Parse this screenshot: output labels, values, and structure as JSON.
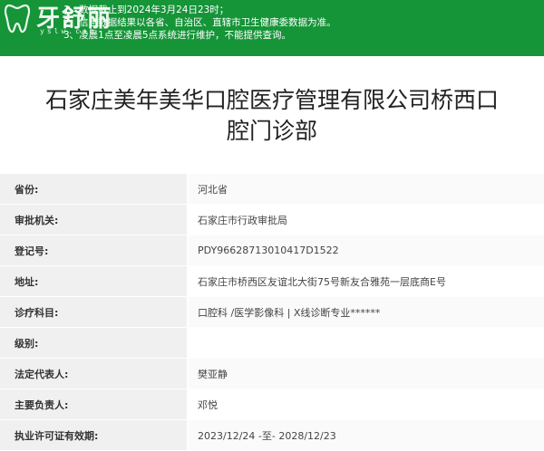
{
  "brand": {
    "logo_text": "牙舒丽",
    "logo_url": "yslw.com"
  },
  "notice": {
    "lines": [
      "1、数据截止到2024年3月24日23时；",
      "2、信息数据结果以各省、自治区、直辖市卫生健康委数据为准。",
      "3、凌晨1点至凌晨5点系统进行维护，不能提供查询。"
    ]
  },
  "title_line1": "石家庄美年美华口腔医疗管理有限公司桥西口",
  "title_line2": "腔门诊部",
  "details": [
    {
      "label": "省份:",
      "value": "河北省"
    },
    {
      "label": "审批机关:",
      "value": "石家庄市行政审批局"
    },
    {
      "label": "登记号:",
      "value": "PDY96628713010417D1522"
    },
    {
      "label": "地址:",
      "value": "石家庄市桥西区友谊北大街75号新友合雅苑一层底商E号"
    },
    {
      "label": "诊疗科目:",
      "value": "口腔科 /医学影像科  |  X线诊断专业******"
    },
    {
      "label": "级别:",
      "value": ""
    },
    {
      "label": "法定代表人:",
      "value": "樊亚静"
    },
    {
      "label": "主要负责人:",
      "value": "邓悦"
    },
    {
      "label": "执业许可证有效期:",
      "value": "2023/12/24 -至- 2028/12/23"
    }
  ],
  "colors": {
    "notice_bg": "#159438",
    "label_bg": "#f0f0f0"
  },
  "icons": [
    "tooth-logo-icon"
  ]
}
